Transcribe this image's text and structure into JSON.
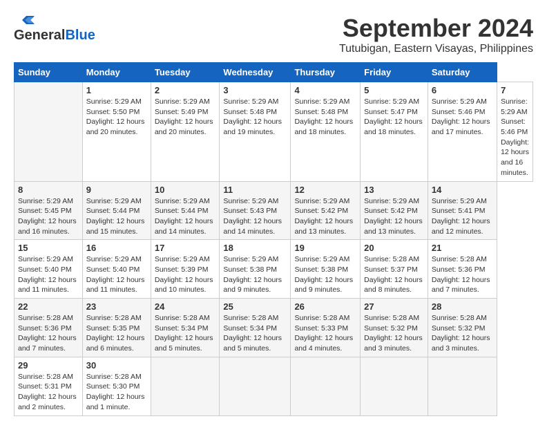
{
  "header": {
    "logo_line1": "General",
    "logo_line2": "Blue",
    "title": "September 2024",
    "subtitle": "Tutubigan, Eastern Visayas, Philippines"
  },
  "calendar": {
    "days_of_week": [
      "Sunday",
      "Monday",
      "Tuesday",
      "Wednesday",
      "Thursday",
      "Friday",
      "Saturday"
    ],
    "weeks": [
      [
        null,
        {
          "day": "1",
          "sunrise": "5:29 AM",
          "sunset": "5:50 PM",
          "daylight": "12 hours and 20 minutes."
        },
        {
          "day": "2",
          "sunrise": "5:29 AM",
          "sunset": "5:49 PM",
          "daylight": "12 hours and 20 minutes."
        },
        {
          "day": "3",
          "sunrise": "5:29 AM",
          "sunset": "5:48 PM",
          "daylight": "12 hours and 19 minutes."
        },
        {
          "day": "4",
          "sunrise": "5:29 AM",
          "sunset": "5:48 PM",
          "daylight": "12 hours and 18 minutes."
        },
        {
          "day": "5",
          "sunrise": "5:29 AM",
          "sunset": "5:47 PM",
          "daylight": "12 hours and 18 minutes."
        },
        {
          "day": "6",
          "sunrise": "5:29 AM",
          "sunset": "5:46 PM",
          "daylight": "12 hours and 17 minutes."
        },
        {
          "day": "7",
          "sunrise": "5:29 AM",
          "sunset": "5:46 PM",
          "daylight": "12 hours and 16 minutes."
        }
      ],
      [
        {
          "day": "8",
          "sunrise": "5:29 AM",
          "sunset": "5:45 PM",
          "daylight": "12 hours and 16 minutes."
        },
        {
          "day": "9",
          "sunrise": "5:29 AM",
          "sunset": "5:44 PM",
          "daylight": "12 hours and 15 minutes."
        },
        {
          "day": "10",
          "sunrise": "5:29 AM",
          "sunset": "5:44 PM",
          "daylight": "12 hours and 14 minutes."
        },
        {
          "day": "11",
          "sunrise": "5:29 AM",
          "sunset": "5:43 PM",
          "daylight": "12 hours and 14 minutes."
        },
        {
          "day": "12",
          "sunrise": "5:29 AM",
          "sunset": "5:42 PM",
          "daylight": "12 hours and 13 minutes."
        },
        {
          "day": "13",
          "sunrise": "5:29 AM",
          "sunset": "5:42 PM",
          "daylight": "12 hours and 13 minutes."
        },
        {
          "day": "14",
          "sunrise": "5:29 AM",
          "sunset": "5:41 PM",
          "daylight": "12 hours and 12 minutes."
        }
      ],
      [
        {
          "day": "15",
          "sunrise": "5:29 AM",
          "sunset": "5:40 PM",
          "daylight": "12 hours and 11 minutes."
        },
        {
          "day": "16",
          "sunrise": "5:29 AM",
          "sunset": "5:40 PM",
          "daylight": "12 hours and 11 minutes."
        },
        {
          "day": "17",
          "sunrise": "5:29 AM",
          "sunset": "5:39 PM",
          "daylight": "12 hours and 10 minutes."
        },
        {
          "day": "18",
          "sunrise": "5:29 AM",
          "sunset": "5:38 PM",
          "daylight": "12 hours and 9 minutes."
        },
        {
          "day": "19",
          "sunrise": "5:29 AM",
          "sunset": "5:38 PM",
          "daylight": "12 hours and 9 minutes."
        },
        {
          "day": "20",
          "sunrise": "5:28 AM",
          "sunset": "5:37 PM",
          "daylight": "12 hours and 8 minutes."
        },
        {
          "day": "21",
          "sunrise": "5:28 AM",
          "sunset": "5:36 PM",
          "daylight": "12 hours and 7 minutes."
        }
      ],
      [
        {
          "day": "22",
          "sunrise": "5:28 AM",
          "sunset": "5:36 PM",
          "daylight": "12 hours and 7 minutes."
        },
        {
          "day": "23",
          "sunrise": "5:28 AM",
          "sunset": "5:35 PM",
          "daylight": "12 hours and 6 minutes."
        },
        {
          "day": "24",
          "sunrise": "5:28 AM",
          "sunset": "5:34 PM",
          "daylight": "12 hours and 5 minutes."
        },
        {
          "day": "25",
          "sunrise": "5:28 AM",
          "sunset": "5:34 PM",
          "daylight": "12 hours and 5 minutes."
        },
        {
          "day": "26",
          "sunrise": "5:28 AM",
          "sunset": "5:33 PM",
          "daylight": "12 hours and 4 minutes."
        },
        {
          "day": "27",
          "sunrise": "5:28 AM",
          "sunset": "5:32 PM",
          "daylight": "12 hours and 3 minutes."
        },
        {
          "day": "28",
          "sunrise": "5:28 AM",
          "sunset": "5:32 PM",
          "daylight": "12 hours and 3 minutes."
        }
      ],
      [
        {
          "day": "29",
          "sunrise": "5:28 AM",
          "sunset": "5:31 PM",
          "daylight": "12 hours and 2 minutes."
        },
        {
          "day": "30",
          "sunrise": "5:28 AM",
          "sunset": "5:30 PM",
          "daylight": "12 hours and 1 minute."
        },
        null,
        null,
        null,
        null,
        null
      ]
    ]
  }
}
